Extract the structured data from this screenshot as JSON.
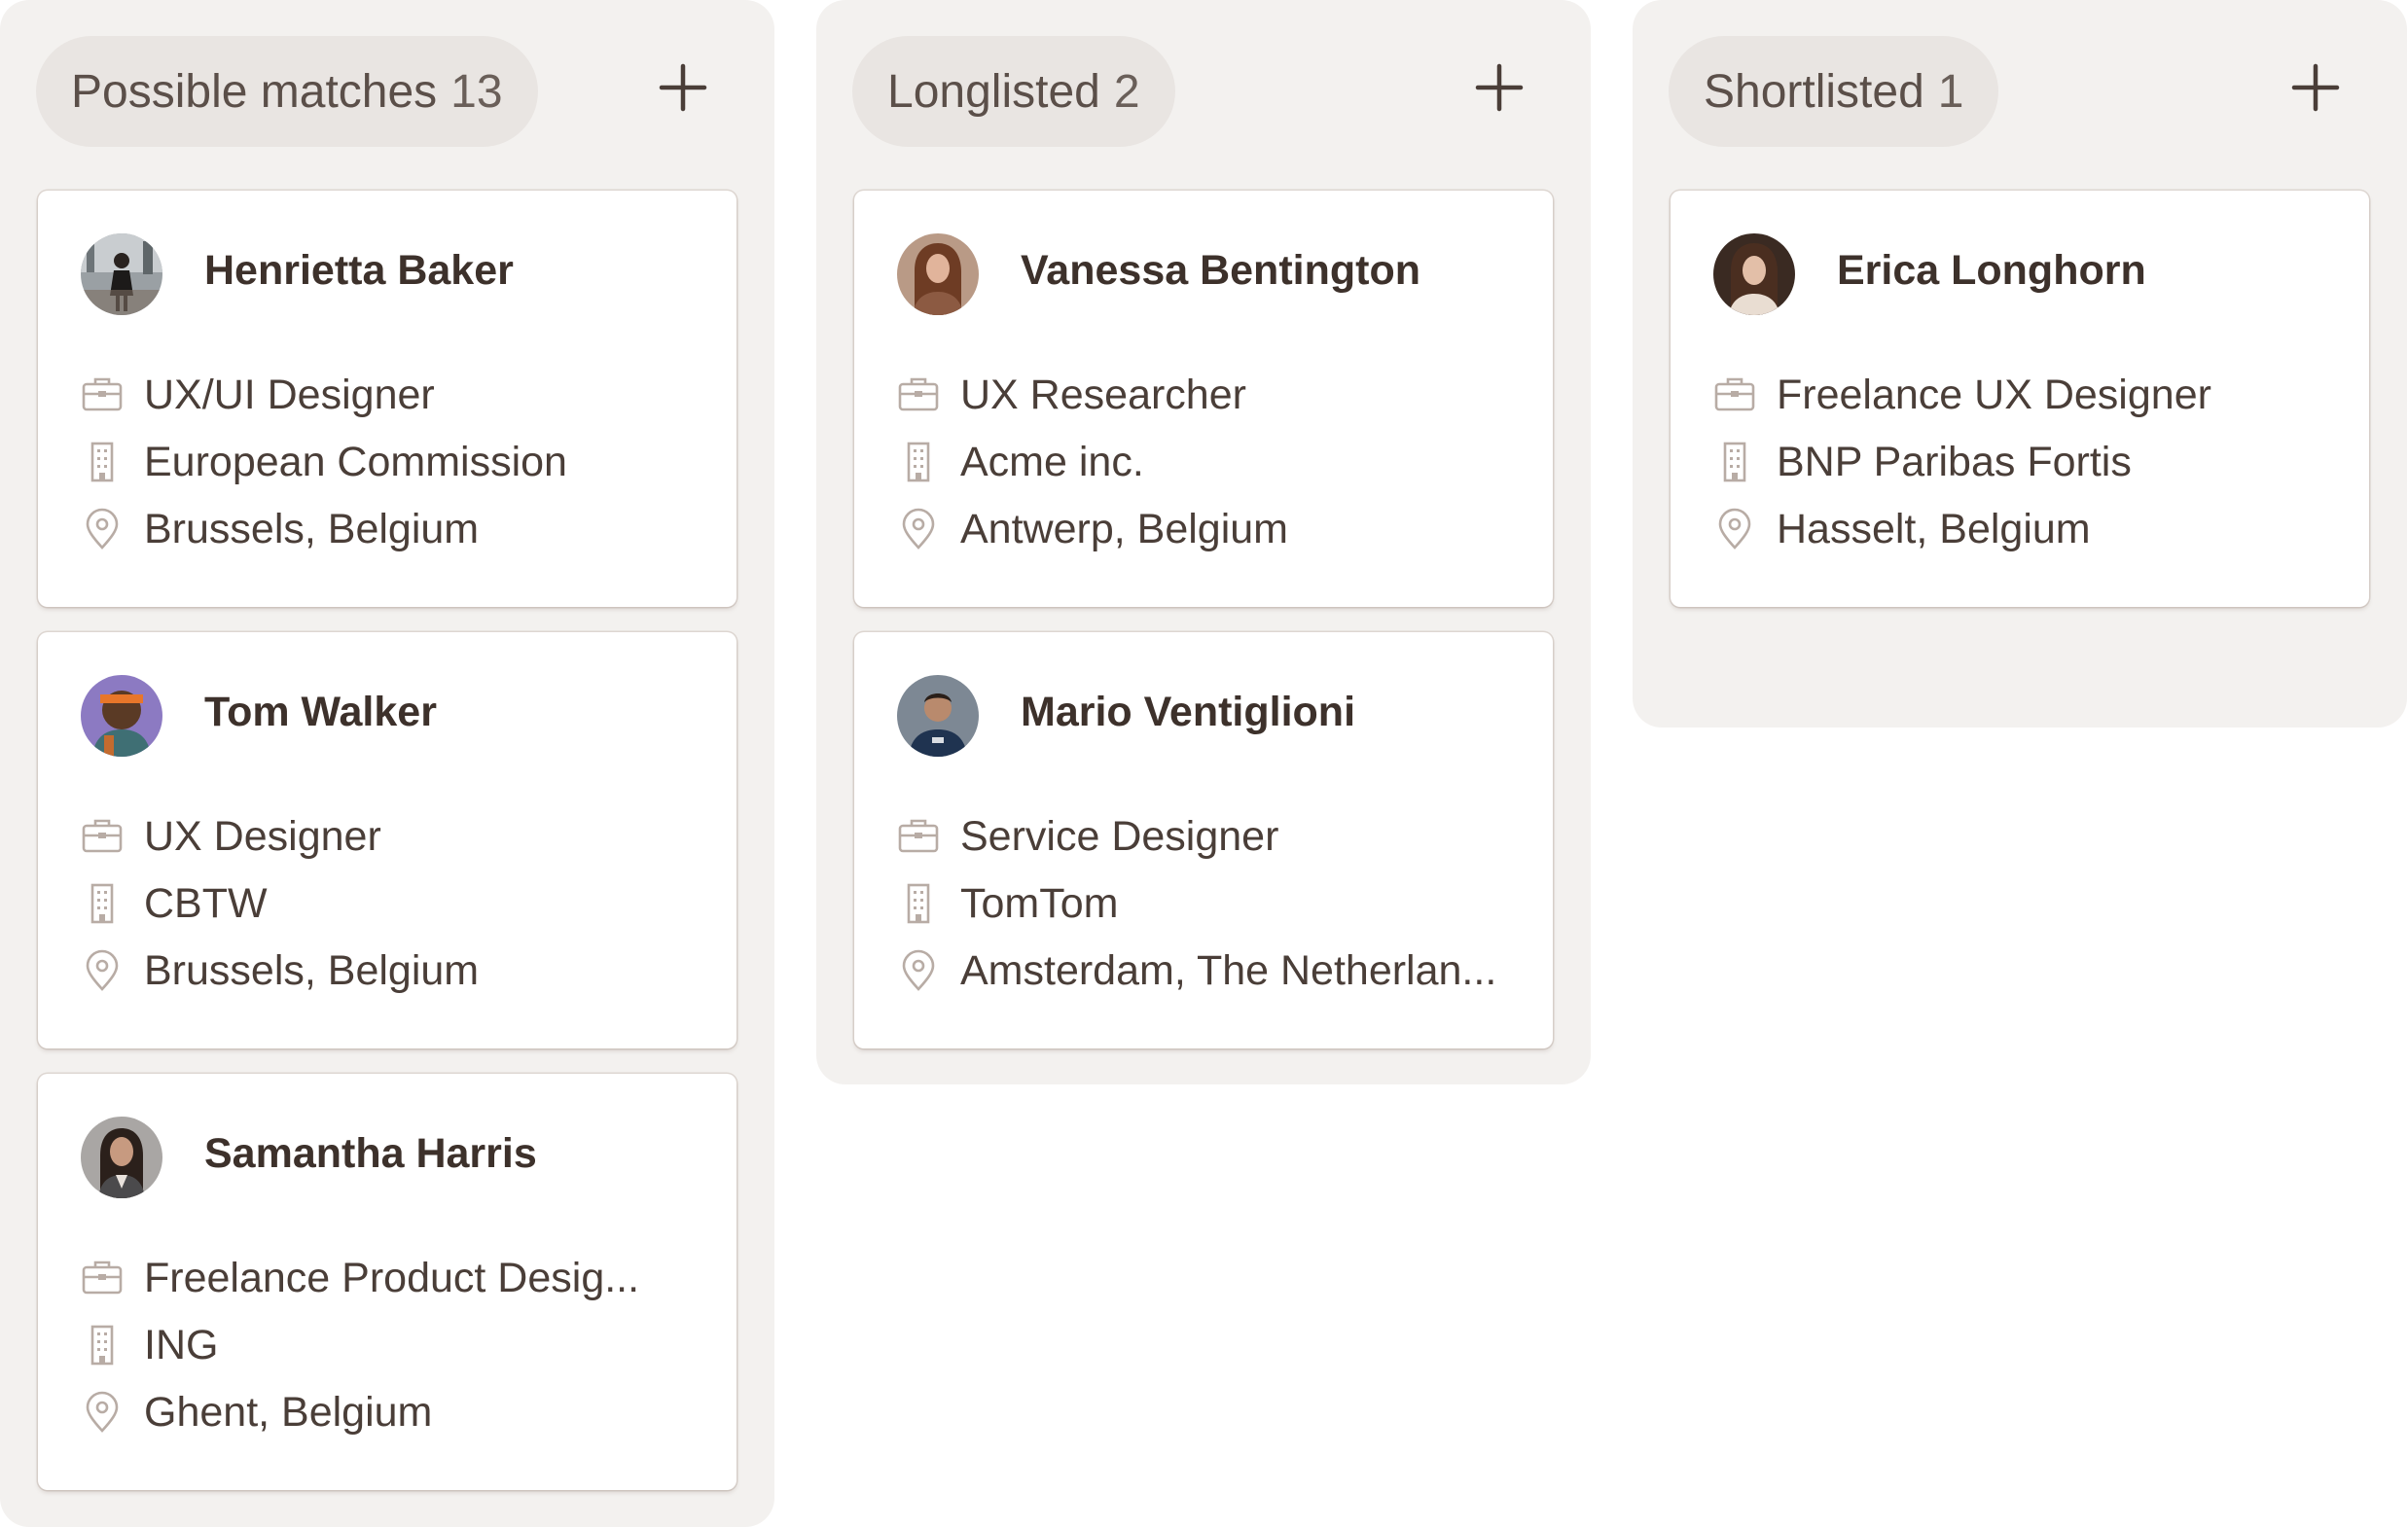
{
  "columns": [
    {
      "title": "Possible matches",
      "count": "13",
      "add_label": "+",
      "cards": [
        {
          "name": "Henrietta Baker",
          "role": "UX/UI Designer",
          "company": "European Commission",
          "location": "Brussels, Belgium"
        },
        {
          "name": "Tom Walker",
          "role": "UX Designer",
          "company": "CBTW",
          "location": "Brussels, Belgium"
        },
        {
          "name": "Samantha Harris",
          "role": "Freelance Product Desig...",
          "company": "ING",
          "location": "Ghent, Belgium"
        }
      ]
    },
    {
      "title": "Longlisted",
      "count": "2",
      "add_label": "+",
      "cards": [
        {
          "name": "Vanessa Bentington",
          "role": "UX Researcher",
          "company": "Acme inc.",
          "location": "Antwerp, Belgium"
        },
        {
          "name": "Mario Ventiglioni",
          "role": "Service Designer",
          "company": "TomTom",
          "location": "Amsterdam, The Netherlan..."
        }
      ]
    },
    {
      "title": "Shortlisted",
      "count": "1",
      "add_label": "+",
      "cards": [
        {
          "name": "Erica Longhorn",
          "role": "Freelance UX Designer",
          "company": "BNP Paribas Fortis",
          "location": "Hasselt, Belgium"
        }
      ]
    }
  ],
  "icons": {
    "role": "briefcase-icon",
    "company": "building-icon",
    "location": "map-pin-icon",
    "add": "plus-icon"
  },
  "colors": {
    "column_bg": "#f3f1ef",
    "pill_bg": "#e9e5e2",
    "card_bg": "#ffffff",
    "icon_color": "#b8aca5",
    "text_primary": "#3d312b"
  }
}
